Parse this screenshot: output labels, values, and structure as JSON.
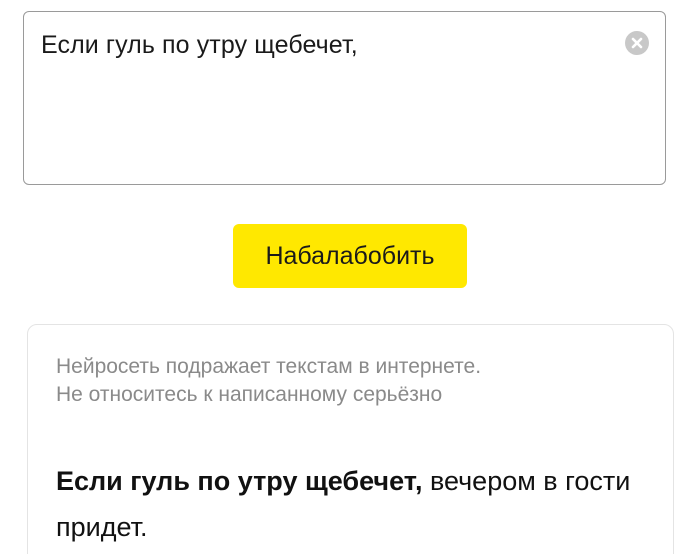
{
  "input": {
    "value": "Если гуль по утру щебечет,",
    "clear_icon": "close-circle-icon"
  },
  "submit": {
    "label": "Набалабобить",
    "color": "#ffe800"
  },
  "result": {
    "disclaimer_line1": "Нейросеть подражает текстам в интернете.",
    "disclaimer_line2": "Не относитесь к написанному серьёзно",
    "prompt_text": "Если гуль по утру щебечет,",
    "generated_text": " вечером в гости придет."
  }
}
